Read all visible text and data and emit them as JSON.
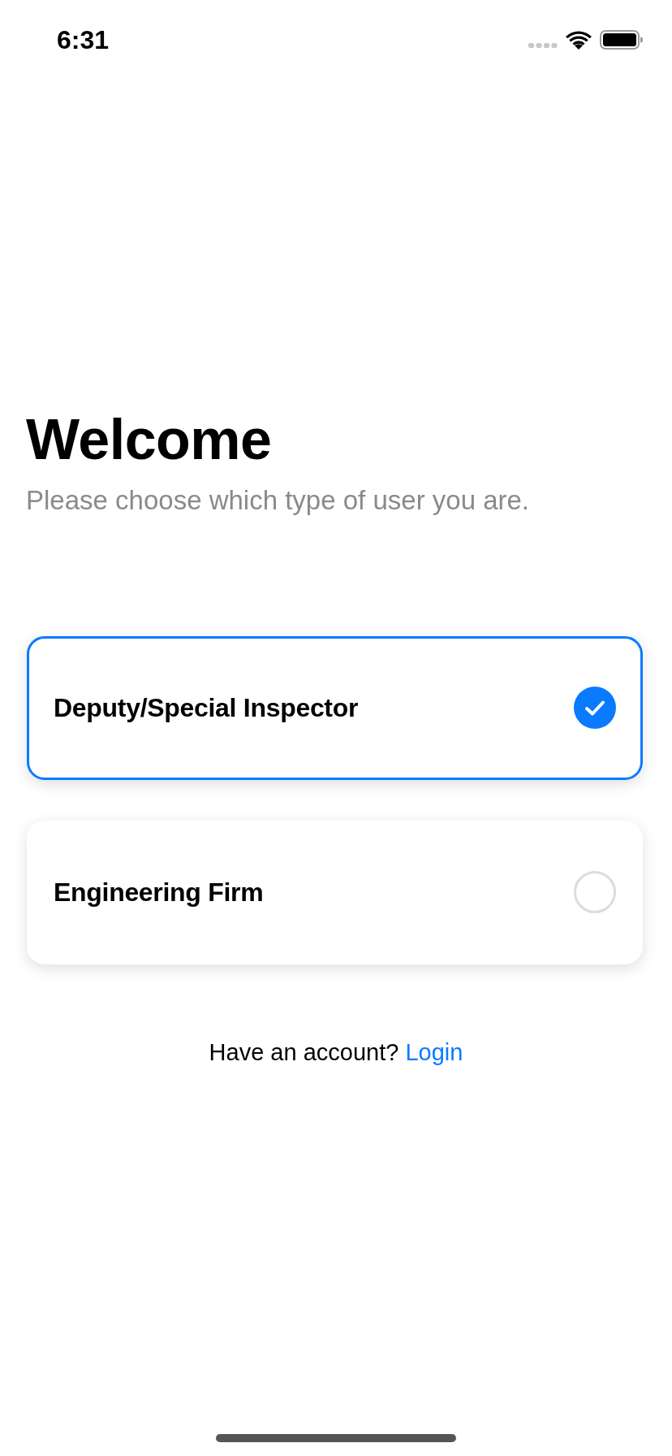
{
  "status_bar": {
    "time": "6:31"
  },
  "header": {
    "title": "Welcome",
    "subtitle": "Please choose which type of user you are."
  },
  "options": [
    {
      "label": "Deputy/Special Inspector",
      "selected": true
    },
    {
      "label": "Engineering Firm",
      "selected": false
    }
  ],
  "footer": {
    "prompt": "Have an account?",
    "link": "Login"
  }
}
